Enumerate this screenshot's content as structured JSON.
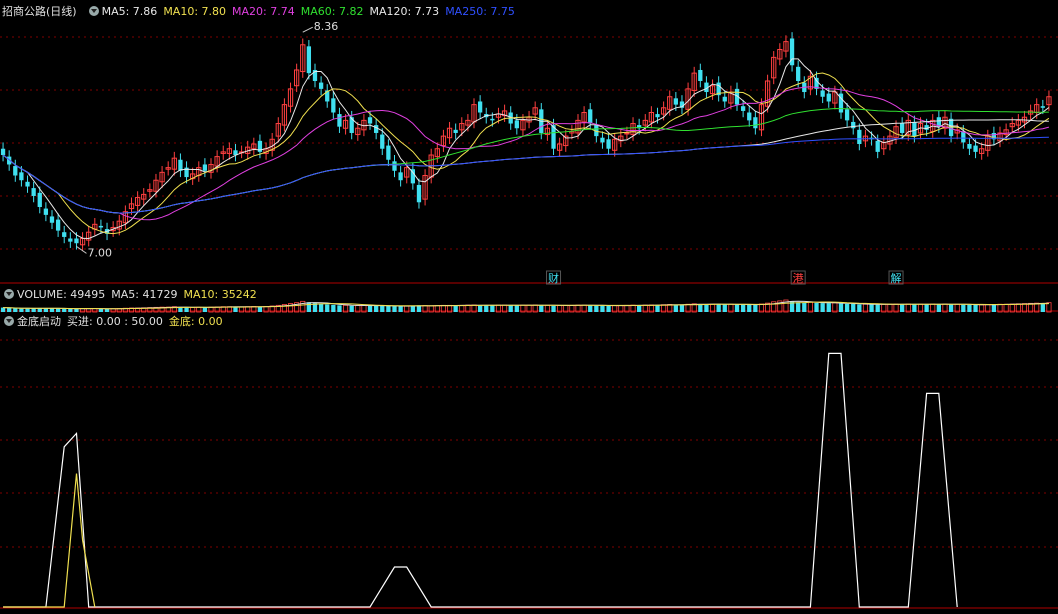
{
  "header": {
    "title": "招商公路(日线)",
    "ma": [
      {
        "label": "MA5: 7.86",
        "color": "#e8e8e8"
      },
      {
        "label": "MA10: 7.80",
        "color": "#f0e050"
      },
      {
        "label": "MA20: 7.74",
        "color": "#e040e0"
      },
      {
        "label": "MA60: 7.82",
        "color": "#30e030"
      },
      {
        "label": "MA120: 7.73",
        "color": "#e8e8e8"
      },
      {
        "label": "MA250: 7.75",
        "color": "#3050ff"
      }
    ]
  },
  "volume_header": {
    "items": [
      {
        "label": "VOLUME: 49495",
        "color": "#e0e0e0"
      },
      {
        "label": "MA5: 41729",
        "color": "#e0e0e0"
      },
      {
        "label": "MA10: 35242",
        "color": "#f0e050"
      }
    ]
  },
  "indicator_header": {
    "title": "金底启动",
    "items": [
      {
        "label": "买进: 0.00 : 50.00",
        "color": "#e0e0e0"
      },
      {
        "label": "金底: 0.00",
        "color": "#f0e050"
      }
    ]
  },
  "colors": {
    "up": "#ff4040",
    "down": "#40e0f0",
    "grid": "#800000"
  },
  "chart_data": [
    {
      "type": "candlestick",
      "name": "price",
      "ylim": [
        6.85,
        8.45
      ],
      "price_labels": [
        {
          "text": "8.36",
          "index": 49,
          "value": 8.36
        },
        {
          "text": "7.00",
          "index": 12,
          "value": 7.0
        }
      ],
      "event_markers": [
        {
          "text": "财",
          "index": 90,
          "color": "#40e0f0"
        },
        {
          "text": "港",
          "index": 130,
          "color": "#ff4040"
        },
        {
          "text": "解",
          "index": 146,
          "color": "#40e0f0"
        }
      ],
      "close": [
        7.58,
        7.52,
        7.45,
        7.42,
        7.38,
        7.32,
        7.25,
        7.2,
        7.15,
        7.1,
        7.06,
        7.03,
        7.02,
        7.05,
        7.09,
        7.14,
        7.12,
        7.08,
        7.12,
        7.16,
        7.22,
        7.27,
        7.31,
        7.33,
        7.36,
        7.42,
        7.47,
        7.5,
        7.56,
        7.48,
        7.44,
        7.46,
        7.5,
        7.48,
        7.52,
        7.57,
        7.6,
        7.62,
        7.58,
        7.6,
        7.63,
        7.65,
        7.6,
        7.62,
        7.68,
        7.78,
        7.9,
        8.0,
        8.12,
        8.28,
        8.1,
        8.05,
        8.0,
        7.92,
        7.85,
        7.76,
        7.8,
        7.72,
        7.75,
        7.8,
        7.78,
        7.72,
        7.62,
        7.55,
        7.48,
        7.42,
        7.5,
        7.4,
        7.28,
        7.45,
        7.58,
        7.62,
        7.7,
        7.75,
        7.72,
        7.78,
        7.8,
        7.9,
        7.85,
        7.82,
        7.8,
        7.84,
        7.86,
        7.78,
        7.75,
        7.8,
        7.82,
        7.88,
        7.72,
        7.75,
        7.62,
        7.65,
        7.7,
        7.73,
        7.8,
        7.85,
        7.78,
        7.7,
        7.66,
        7.62,
        7.68,
        7.7,
        7.72,
        7.78,
        7.75,
        7.8,
        7.85,
        7.82,
        7.88,
        7.95,
        7.9,
        7.88,
        8.0,
        8.1,
        8.05,
        7.98,
        8.02,
        7.96,
        7.92,
        7.98,
        7.9,
        7.86,
        7.8,
        7.75,
        7.9,
        8.05,
        8.2,
        8.25,
        8.3,
        8.15,
        8.05,
        7.98,
        8.08,
        8.0,
        7.95,
        7.92,
        7.98,
        7.85,
        7.8,
        7.75,
        7.65,
        7.7,
        7.68,
        7.6,
        7.66,
        7.7,
        7.76,
        7.72,
        7.8,
        7.7,
        7.78,
        7.74,
        7.8,
        7.76,
        7.82,
        7.7,
        7.74,
        7.66,
        7.62,
        7.6,
        7.62,
        7.7,
        7.68,
        7.72,
        7.74,
        7.78,
        7.8,
        7.82,
        7.86,
        7.9,
        7.88,
        7.95
      ],
      "volume": [
        20,
        18,
        16,
        15,
        15,
        16,
        18,
        17,
        16,
        15,
        14,
        14,
        15,
        16,
        16,
        15,
        14,
        14,
        15,
        16,
        17,
        18,
        18,
        19,
        20,
        21,
        22,
        22,
        24,
        22,
        20,
        20,
        21,
        21,
        22,
        23,
        24,
        24,
        23,
        23,
        24,
        25,
        24,
        25,
        27,
        30,
        34,
        38,
        42,
        48,
        44,
        40,
        36,
        34,
        32,
        30,
        30,
        28,
        29,
        30,
        29,
        28,
        27,
        27,
        26,
        26,
        27,
        28,
        30,
        29,
        28,
        29,
        30,
        30,
        29,
        30,
        31,
        32,
        31,
        30,
        30,
        31,
        31,
        30,
        30,
        31,
        31,
        32,
        30,
        30,
        28,
        29,
        30,
        30,
        31,
        31,
        30,
        29,
        29,
        28,
        29,
        29,
        30,
        31,
        30,
        31,
        32,
        31,
        33,
        34,
        33,
        33,
        35,
        37,
        36,
        35,
        35,
        34,
        34,
        35,
        34,
        33,
        33,
        32,
        36,
        40,
        46,
        50,
        54,
        48,
        44,
        42,
        44,
        41,
        40,
        40,
        41,
        38,
        37,
        36,
        34,
        35,
        34,
        33,
        34,
        35,
        36,
        35,
        36,
        34,
        35,
        35,
        36,
        35,
        36,
        34,
        35,
        33,
        32,
        32,
        32,
        34,
        34,
        35,
        35,
        36,
        37,
        38,
        39,
        40,
        40,
        42
      ]
    },
    {
      "type": "line",
      "name": "金底启动",
      "ylim": [
        0,
        100
      ],
      "series": [
        {
          "name": "买进",
          "color": "#ffffff",
          "points": [
            [
              0,
              0
            ],
            [
              7,
              0
            ],
            [
              10,
              60
            ],
            [
              12,
              65
            ],
            [
              14,
              0
            ],
            [
              60,
              0
            ],
            [
              64,
              15
            ],
            [
              66,
              15
            ],
            [
              70,
              0
            ],
            [
              132,
              0
            ],
            [
              135,
              95
            ],
            [
              137,
              95
            ],
            [
              140,
              0
            ],
            [
              148,
              0
            ],
            [
              151,
              80
            ],
            [
              153,
              80
            ],
            [
              156,
              0
            ]
          ]
        },
        {
          "name": "金底",
          "color": "#f0e050",
          "points": [
            [
              0,
              0
            ],
            [
              10,
              0
            ],
            [
              12,
              50
            ],
            [
              13,
              25
            ],
            [
              15,
              0
            ]
          ]
        }
      ]
    }
  ]
}
